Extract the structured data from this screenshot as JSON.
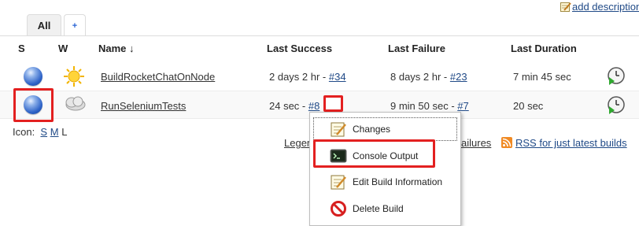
{
  "header": {
    "add_description": "add description",
    "tabs": [
      {
        "label": "All"
      },
      {
        "label": "+"
      }
    ]
  },
  "table": {
    "columns": {
      "s": "S",
      "w": "W",
      "name": "Name ↓",
      "last_success": "Last Success",
      "last_failure": "Last Failure",
      "last_duration": "Last Duration"
    },
    "rows": [
      {
        "name": "BuildRocketChatOnNode",
        "last_success_text": "2 days 2 hr - ",
        "last_success_link": "#34",
        "last_failure_text": "8 days 2 hr - ",
        "last_failure_link": "#23",
        "last_duration": "7 min 45 sec"
      },
      {
        "name": "RunSeleniumTests",
        "last_success_text": "24 sec - ",
        "last_success_link": "#8",
        "last_failure_text": "9 min 50 sec - ",
        "last_failure_link": "#7",
        "last_duration": "20 sec"
      }
    ]
  },
  "icon_size": {
    "label": "Icon:",
    "s": "S",
    "m": "M",
    "l": "L"
  },
  "legend": {
    "legend_link": "Legen",
    "failures_link": "ailures",
    "rss_latest": "RSS for just latest builds"
  },
  "context_menu": {
    "items": [
      {
        "label": "Changes",
        "icon": "notepad-icon"
      },
      {
        "label": "Console Output",
        "icon": "terminal-icon"
      },
      {
        "label": "Edit Build Information",
        "icon": "notepad-pencil-icon"
      },
      {
        "label": "Delete Build",
        "icon": "no-entry-icon"
      }
    ]
  },
  "colors": {
    "link": "#204a87",
    "highlight": "#e32020",
    "status_blue": "#2e63c8"
  }
}
